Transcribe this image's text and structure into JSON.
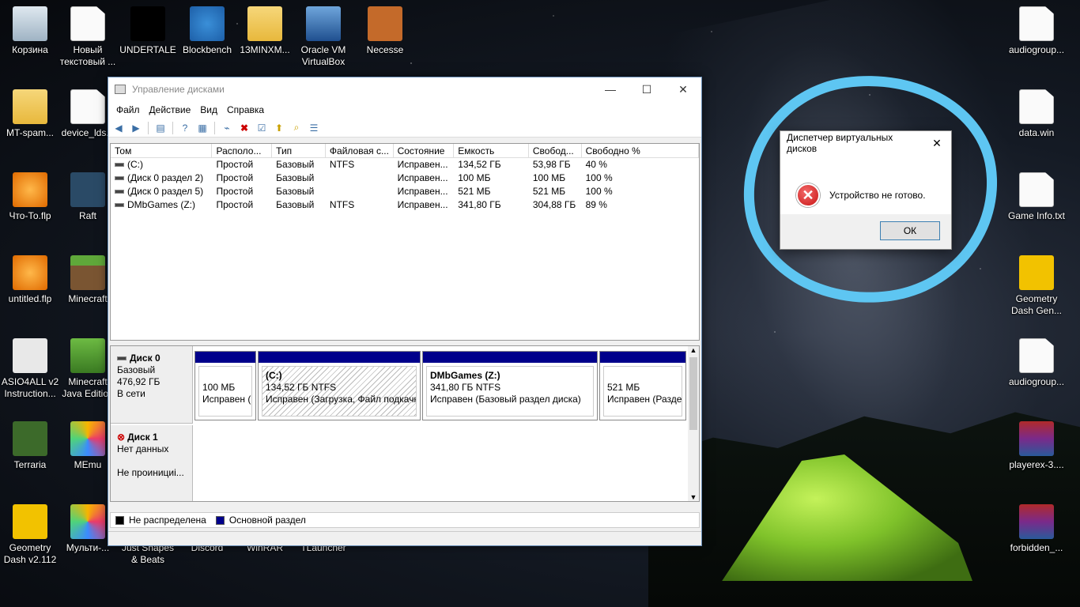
{
  "desktop": {
    "left_icons": [
      {
        "label": "Корзина",
        "icon": "recycle-bin-icon"
      },
      {
        "label": "Новый текстовый ...",
        "icon": "text-document-icon"
      },
      {
        "label": "UNDERTALE",
        "icon": "undertale-heart-icon"
      },
      {
        "label": "Blockbench",
        "icon": "blockbench-icon"
      },
      {
        "label": "13MINXM...",
        "icon": "zip-folder-icon"
      },
      {
        "label": "Oracle VM VirtualBox",
        "icon": "virtualbox-icon"
      },
      {
        "label": "Necesse",
        "icon": "necesse-icon"
      },
      {
        "label": "MT-spam...",
        "icon": "folder-icon"
      },
      {
        "label": "device_lds...",
        "icon": "document-icon"
      },
      {
        "label": "Что-То.flp",
        "icon": "fl-studio-icon"
      },
      {
        "label": "Raft",
        "icon": "raft-icon"
      },
      {
        "label": "untitled.flp",
        "icon": "fl-studio-icon"
      },
      {
        "label": "Minecraft",
        "icon": "minecraft-icon"
      },
      {
        "label": "ASIO4ALL v2 Instruction...",
        "icon": "pdf-icon"
      },
      {
        "label": "Minecraft Java Edition",
        "icon": "minecraft-grass-icon"
      },
      {
        "label": "Terraria",
        "icon": "terraria-icon"
      },
      {
        "label": "MEmu",
        "icon": "memu-icon"
      },
      {
        "label": "Geometry Dash v2.112",
        "icon": "geometry-dash-icon"
      },
      {
        "label": "Мульти-...",
        "icon": "multi-memu-icon"
      },
      {
        "label": "Just Shapes & Beats",
        "icon": "jsb-icon"
      },
      {
        "label": "Discord",
        "icon": "discord-icon"
      },
      {
        "label": "WinRAR",
        "icon": "winrar-icon"
      },
      {
        "label": "TLauncher",
        "icon": "tlauncher-icon"
      }
    ],
    "right_icons": [
      {
        "label": "audiogroup...",
        "icon": "document-icon"
      },
      {
        "label": "data.win",
        "icon": "document-icon"
      },
      {
        "label": "Game Info.txt",
        "icon": "text-document-icon"
      },
      {
        "label": "Geometry Dash Gen...",
        "icon": "geometry-dash-icon"
      },
      {
        "label": "audiogroup...",
        "icon": "document-icon"
      },
      {
        "label": "playerex-3....",
        "icon": "winrar-archive-icon"
      },
      {
        "label": "forbidden_...",
        "icon": "winrar-archive-icon"
      }
    ]
  },
  "disk_mgmt": {
    "title": "Управление дисками",
    "menu": [
      "Файл",
      "Действие",
      "Вид",
      "Справка"
    ],
    "columns": [
      "Том",
      "Располо...",
      "Тип",
      "Файловая с...",
      "Состояние",
      "Емкость",
      "Свобод...",
      "Свободно %"
    ],
    "rows": [
      [
        "(C:)",
        "Простой",
        "Базовый",
        "NTFS",
        "Исправен...",
        "134,52 ГБ",
        "53,98 ГБ",
        "40 %"
      ],
      [
        "(Диск 0 раздел 2)",
        "Простой",
        "Базовый",
        "",
        "Исправен...",
        "100 МБ",
        "100 МБ",
        "100 %"
      ],
      [
        "(Диск 0 раздел 5)",
        "Простой",
        "Базовый",
        "",
        "Исправен...",
        "521 МБ",
        "521 МБ",
        "100 %"
      ],
      [
        "DMbGames (Z:)",
        "Простой",
        "Базовый",
        "NTFS",
        "Исправен...",
        "341,80 ГБ",
        "304,88 ГБ",
        "89 %"
      ]
    ],
    "disk0": {
      "name": "Диск 0",
      "type": "Базовый",
      "size": "476,92 ГБ",
      "status": "В сети"
    },
    "disk1": {
      "name": "Диск 1",
      "line1": "Нет данных",
      "line2": "Не проинициi..."
    },
    "partitions": [
      {
        "title": "",
        "size": "100 МБ",
        "state": "Исправен (l"
      },
      {
        "title": "(C:)",
        "size": "134,52 ГБ NTFS",
        "state": "Исправен (Загрузка, Файл подкачк"
      },
      {
        "title": "DMbGames  (Z:)",
        "size": "341,80 ГБ NTFS",
        "state": "Исправен (Базовый раздел диска)"
      },
      {
        "title": "",
        "size": "521 МБ",
        "state": "Исправен (Разде"
      }
    ],
    "legend": {
      "unallocated": "Не распределена",
      "primary": "Основной раздел"
    }
  },
  "dialog": {
    "title": "Диспетчер виртуальных дисков",
    "message": "Устройство не готово.",
    "ok": "ОК"
  },
  "colors": {
    "accent_ring": "#5ec6f2",
    "partition_bar": "#00008b"
  }
}
